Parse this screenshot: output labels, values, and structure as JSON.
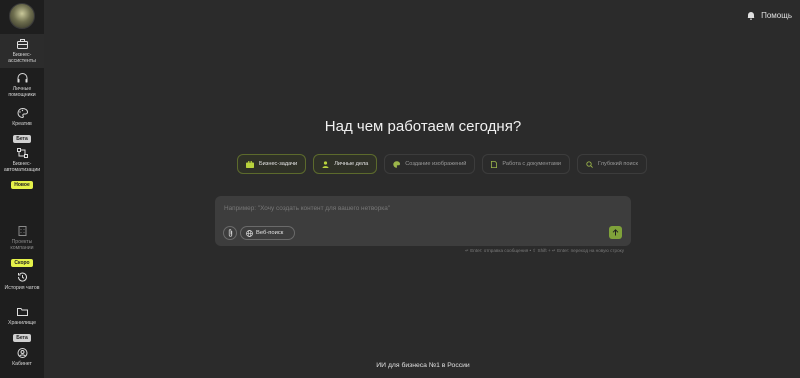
{
  "sidebar": {
    "items": [
      {
        "label": "Бизнес-ассистенты",
        "icon": "briefcase-icon",
        "badge": ""
      },
      {
        "label": "Личные помощники",
        "icon": "headphones-icon",
        "badge": ""
      },
      {
        "label": "Креатив",
        "icon": "palette-icon",
        "badge": "Бета"
      },
      {
        "label": "Бизнес-автоматизации",
        "icon": "flow-icon",
        "badge": "Новое"
      },
      {
        "label": "Проекты компании",
        "icon": "building-icon",
        "badge": "Скоро"
      },
      {
        "label": "История чатов",
        "icon": "history-icon",
        "badge": ""
      },
      {
        "label": "Хранилище",
        "icon": "folder-icon",
        "badge": "Бета"
      },
      {
        "label": "Кабинет",
        "icon": "user-circle-icon",
        "badge": ""
      }
    ]
  },
  "header": {
    "help_label": "Помощь"
  },
  "main": {
    "headline": "Над чем работаем сегодня?",
    "chips": [
      {
        "label": "Бизнес-задачи",
        "icon": "briefcase-icon"
      },
      {
        "label": "Личные дела",
        "icon": "person-icon"
      },
      {
        "label": "Создание изображений",
        "icon": "palette-icon"
      },
      {
        "label": "Работа с документами",
        "icon": "document-icon"
      },
      {
        "label": "Глубокий поиск",
        "icon": "search-icon"
      }
    ],
    "input": {
      "placeholder": "Например: \"Хочу создать контент для вашего нетворка\"",
      "web_search_label": "Веб-поиск"
    },
    "hint": "↵ Enter: отправка сообщения • ⇧ Shift + ↵ Enter: переход на новую строку",
    "footer": "ИИ для бизнеса №1 в России"
  },
  "colors": {
    "accent": "#7fa23a",
    "badge_new": "#e5f24a",
    "background": "#2b2b2b",
    "sidebar": "#1e1e1e"
  }
}
